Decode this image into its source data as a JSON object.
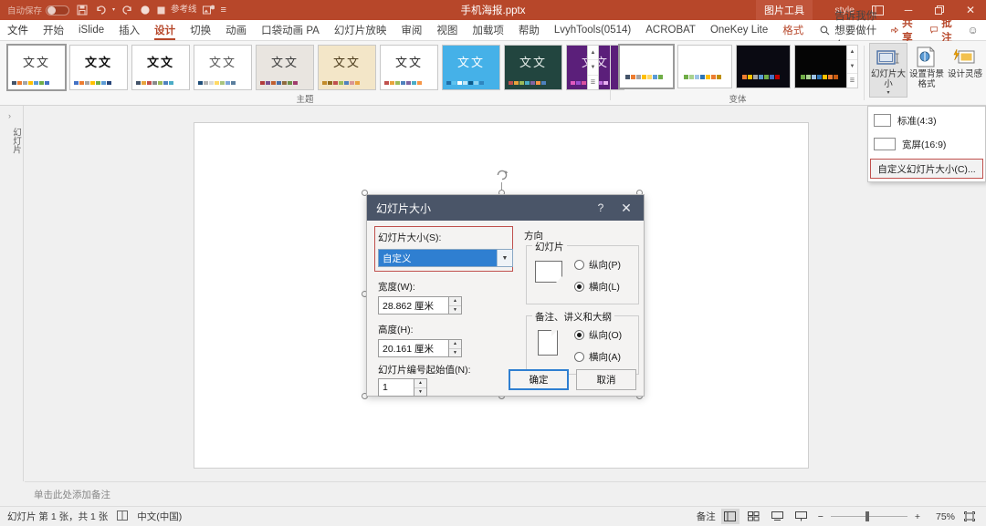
{
  "titlebar": {
    "autosave_label": "自动保存",
    "qat": [
      {
        "name": "save-icon",
        "glyph": "ὋE"
      },
      {
        "name": "undo-icon",
        "glyph": "↶"
      },
      {
        "name": "redo-icon",
        "glyph": "↻"
      },
      {
        "name": "record-icon",
        "glyph": "●"
      },
      {
        "name": "guides-icon",
        "glyph": "■"
      }
    ],
    "guides_label": "参考线",
    "document_title": "手机海报.pptx",
    "contextual_tools": "图片工具",
    "style_label": "style",
    "ribbon_display_icon": "ribbon-display-options-icon",
    "minimize_icon": "─",
    "restore_icon": "❐",
    "close_icon": "✕"
  },
  "tabs": [
    {
      "label": "文件",
      "active": false,
      "ctx": false
    },
    {
      "label": "开始",
      "active": false,
      "ctx": false
    },
    {
      "label": "iSlide",
      "active": false,
      "ctx": false
    },
    {
      "label": "插入",
      "active": false,
      "ctx": false
    },
    {
      "label": "设计",
      "active": true,
      "ctx": false
    },
    {
      "label": "切换",
      "active": false,
      "ctx": false
    },
    {
      "label": "动画",
      "active": false,
      "ctx": false
    },
    {
      "label": "口袋动画 PA",
      "active": false,
      "ctx": false
    },
    {
      "label": "幻灯片放映",
      "active": false,
      "ctx": false
    },
    {
      "label": "审阅",
      "active": false,
      "ctx": false
    },
    {
      "label": "视图",
      "active": false,
      "ctx": false
    },
    {
      "label": "加载项",
      "active": false,
      "ctx": false
    },
    {
      "label": "帮助",
      "active": false,
      "ctx": false
    },
    {
      "label": "LvyhTools(0514)",
      "active": false,
      "ctx": false
    },
    {
      "label": "ACROBAT",
      "active": false,
      "ctx": false
    },
    {
      "label": "OneKey Lite",
      "active": false,
      "ctx": false
    },
    {
      "label": "格式",
      "active": false,
      "ctx": true
    }
  ],
  "tellme": {
    "placeholder": "告诉我你想要做什么"
  },
  "tabbar_right": {
    "share_label": "共享",
    "comment_label": "批注",
    "smiley": "☺"
  },
  "ribbon": {
    "themes_group_label": "主题",
    "variants_group_label": "变体",
    "theme_thumb_text": "文文",
    "themes": [
      {
        "name": "theme-office",
        "selected": true,
        "bg": "#ffffff",
        "text_color": "#3a3a3a",
        "bold": false,
        "swatches": [
          "#44546a",
          "#ed7d31",
          "#a5a5a5",
          "#ffc000",
          "#5b9bd5",
          "#70ad47",
          "#4472c4"
        ]
      },
      {
        "name": "theme-facet",
        "selected": false,
        "bg": "#ffffff",
        "text_color": "#111111",
        "bold": true,
        "swatches": [
          "#4472c4",
          "#ed7d31",
          "#a5a5a5",
          "#ffc000",
          "#70ad47",
          "#5b9bd5",
          "#264478"
        ]
      },
      {
        "name": "theme-berlin",
        "selected": false,
        "bg": "#ffffff",
        "text_color": "#111111",
        "bold": true,
        "swatches": [
          "#44546a",
          "#e8a33d",
          "#c3514e",
          "#8a8a8a",
          "#9bbb59",
          "#4f81bd",
          "#4bacc6"
        ]
      },
      {
        "name": "theme-celestial",
        "selected": false,
        "bg": "#ffffff",
        "text_color": "#555555",
        "bold": false,
        "swatches": [
          "#1f4e79",
          "#b3b3b3",
          "#d9d9d9",
          "#ffd966",
          "#a9c47f",
          "#7ea6d8",
          "#5b7f9e"
        ]
      },
      {
        "name": "theme-gallery",
        "selected": false,
        "bg": "#e9e5e0",
        "text_color": "#3a3a3a",
        "bold": false,
        "swatches": [
          "#b23c3c",
          "#7b4f8f",
          "#c06030",
          "#4a6fa5",
          "#8f6b3f",
          "#6d8f4a",
          "#a03c6c"
        ]
      },
      {
        "name": "theme-wisp",
        "selected": false,
        "bg": "#f3e6c8",
        "text_color": "#4a3a1a",
        "bold": false,
        "swatches": [
          "#c28b2a",
          "#8f6b1f",
          "#c0504d",
          "#9bbb59",
          "#4f81bd",
          "#d99694",
          "#e8a33d"
        ]
      },
      {
        "name": "theme-banded",
        "selected": false,
        "bg": "#ffffff",
        "text_color": "#2a2a2a",
        "bold": false,
        "swatches": [
          "#c0504d",
          "#e8a33d",
          "#9bbb59",
          "#4f81bd",
          "#8064a2",
          "#4bacc6",
          "#f79646"
        ]
      },
      {
        "name": "theme-dots",
        "selected": false,
        "bg": "#45b1e8",
        "text_color": "#ffffff",
        "bold": false,
        "swatches": [
          "#1f6fa8",
          "#5fc3ef",
          "#ffffff",
          "#bfe6f7",
          "#0e5a8a",
          "#8fd4f2",
          "#2f86c0"
        ]
      },
      {
        "name": "theme-dividend",
        "selected": false,
        "bg": "#22453f",
        "text_color": "#e8f0ec",
        "bold": false,
        "swatches": [
          "#c0504d",
          "#e8a33d",
          "#9bbb59",
          "#4bacc6",
          "#8064a2",
          "#f79646",
          "#4f81bd"
        ]
      },
      {
        "name": "theme-quotable",
        "selected": false,
        "bg": "#5b1f7a",
        "text_color": "#f2e3f7",
        "bold": false,
        "swatches": [
          "#e05ac0",
          "#9b4fd1",
          "#d94fa0",
          "#f0a0e0",
          "#7b3fb5",
          "#c070e0",
          "#e8b0f0"
        ]
      }
    ],
    "variants": [
      {
        "name": "variant-1",
        "selected": true,
        "bg": "#ffffff",
        "swatches": [
          "#44546a",
          "#ed7d31",
          "#a5a5a5",
          "#ffc000",
          "#ffd966",
          "#5b9bd5",
          "#70ad47"
        ]
      },
      {
        "name": "variant-2",
        "selected": false,
        "bg": "#ffffff",
        "swatches": [
          "#70ad47",
          "#a9d18e",
          "#9dc3e6",
          "#2e75b6",
          "#ffc000",
          "#ed7d31",
          "#bf9000"
        ]
      },
      {
        "name": "variant-3",
        "selected": false,
        "bg": "#0a0a12",
        "swatches": [
          "#ed7d31",
          "#ffc000",
          "#a5a5a5",
          "#5b9bd5",
          "#70ad47",
          "#4472c4",
          "#c00000"
        ]
      },
      {
        "name": "variant-4",
        "selected": false,
        "bg": "#050505",
        "swatches": [
          "#70ad47",
          "#a9d18e",
          "#9dc3e6",
          "#2e75b6",
          "#ffc000",
          "#ed7d31",
          "#c55a11"
        ]
      }
    ],
    "gallery_scroll": {
      "up": "▲",
      "down": "▼",
      "more": "☰"
    },
    "buttons": [
      {
        "name": "slide-size-button",
        "label": "幻灯片大小",
        "icon": "slide-size-icon",
        "active": true,
        "has_caret": true
      },
      {
        "name": "format-background-button",
        "label": "设置背景格式",
        "icon": "format-background-icon",
        "active": false,
        "has_caret": false
      },
      {
        "name": "design-ideas-button",
        "label": "设计灵感",
        "icon": "design-ideas-icon",
        "active": false,
        "has_caret": false
      }
    ]
  },
  "dropdown": {
    "items": [
      {
        "name": "standard-4-3",
        "label": "标准(4:3)",
        "aspect": "4:3",
        "highlighted": false
      },
      {
        "name": "widescreen-16-9",
        "label": "宽屏(16:9)",
        "aspect": "16:9",
        "highlighted": false
      },
      {
        "name": "custom-slide-size",
        "label": "自定义幻灯片大小(C)...",
        "aspect": "",
        "highlighted": true
      }
    ]
  },
  "thumbnail_pane": {
    "expand_arrow": "›",
    "vertical_label": "幻灯片"
  },
  "notes": {
    "placeholder": "单击此处添加备注"
  },
  "dialog": {
    "title": "幻灯片大小",
    "help_icon": "?",
    "close_icon": "✕",
    "slide_size_label": "幻灯片大小(S):",
    "slide_size_value": "自定义",
    "width_label": "宽度(W):",
    "width_value": "28.862 厘米",
    "height_label": "高度(H):",
    "height_value": "20.161 厘米",
    "number_label": "幻灯片编号起始值(N):",
    "number_value": "1",
    "orientation_label": "方向",
    "slides_legend": "幻灯片",
    "slides_portrait": "纵向(P)",
    "slides_landscape": "横向(L)",
    "slides_selected": "landscape",
    "notes_legend": "备注、讲义和大纲",
    "notes_portrait": "纵向(O)",
    "notes_landscape": "横向(A)",
    "notes_selected": "portrait",
    "ok_label": "确定",
    "cancel_label": "取消"
  },
  "statusbar": {
    "slide_count": "幻灯片 第 1 张，共 1 张",
    "language_icon": "spellcheck-icon",
    "language": "中文(中国)",
    "notes_button": "备注",
    "views": [
      {
        "name": "normal-view-button",
        "glyph": "▤",
        "active": true
      },
      {
        "name": "slide-sorter-button",
        "glyph": "▦",
        "active": false
      },
      {
        "name": "reading-view-button",
        "glyph": "▧",
        "active": false
      },
      {
        "name": "slideshow-button",
        "glyph": "▷",
        "active": false
      }
    ],
    "zoom_out": "−",
    "zoom_in": "+",
    "zoom_level": "75%",
    "fit_icon": "fit-slide-icon"
  },
  "colors": {
    "brand": "#b7472a",
    "accent_red": "#c0504d",
    "dialog_titlebar": "#4a5568",
    "combo_blue": "#2f7fd1"
  }
}
